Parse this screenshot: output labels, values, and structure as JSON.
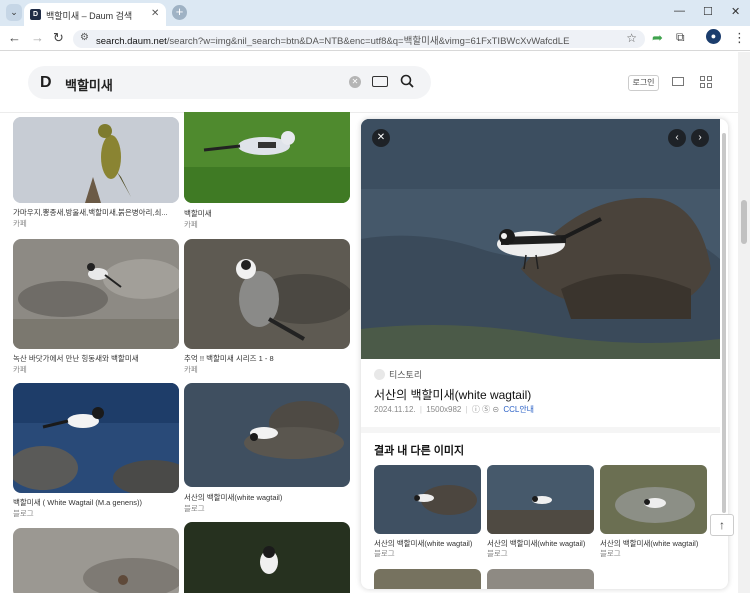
{
  "browser": {
    "tab_title": "백할미새 – Daum 검색",
    "favicon_letter": "D",
    "url_host": "search.daum.net",
    "url_rest": "/search?w=img&nil_search=btn&DA=NTB&enc=utf8&q=백할미새&vimg=61FxTIBWcXvWafcdLE"
  },
  "header": {
    "logo": "D",
    "query": "백할미새",
    "login_label": "로그인"
  },
  "results": [
    {
      "title": "가마우지,뽕종새,방울새,백할미새,붉은병아리,쇠...",
      "source": "카페"
    },
    {
      "title": "백할미새",
      "source": "카페"
    },
    {
      "title": "녹산 바닷가에서 만난 힝동새와 백할미새",
      "source": "카페"
    },
    {
      "title": "추억 !! 백할미새 시리즈 1 - 8",
      "source": "카페"
    },
    {
      "title": "백할미새 ( White Wagtail (M.a genens))",
      "source": "블로그"
    },
    {
      "title": "서산의 백할미새(white wagtail)",
      "source": "블로그"
    }
  ],
  "detail": {
    "source_name": "티스토리",
    "title": "서산의 백할미새(white wagtail)",
    "date": "2024.11.12.",
    "size": "1500x982",
    "license": "CCL안내",
    "related_heading": "결과 내 다른 이미지",
    "related": [
      {
        "title": "서산의 백할미새(white wagtail)",
        "source": "블로그"
      },
      {
        "title": "서산의 백할미새(white wagtail)",
        "source": "블로그"
      },
      {
        "title": "서산의 백할미새(white wagtail)",
        "source": "블로그"
      }
    ]
  },
  "colors": {
    "accent_link": "#2d63c7",
    "chrome_bg": "#dce8f3"
  },
  "icons": [
    "tab-list-icon",
    "close-icon",
    "plus-icon",
    "minimize-icon",
    "maximize-icon",
    "back-icon",
    "forward-icon",
    "reload-icon",
    "site-info-icon",
    "star-icon",
    "share-icon",
    "extensions-icon",
    "profile-icon",
    "menu-icon",
    "clear-icon",
    "keyboard-icon",
    "search-icon",
    "mail-icon",
    "apps-icon",
    "prev-icon",
    "next-icon",
    "arrow-up-icon"
  ]
}
